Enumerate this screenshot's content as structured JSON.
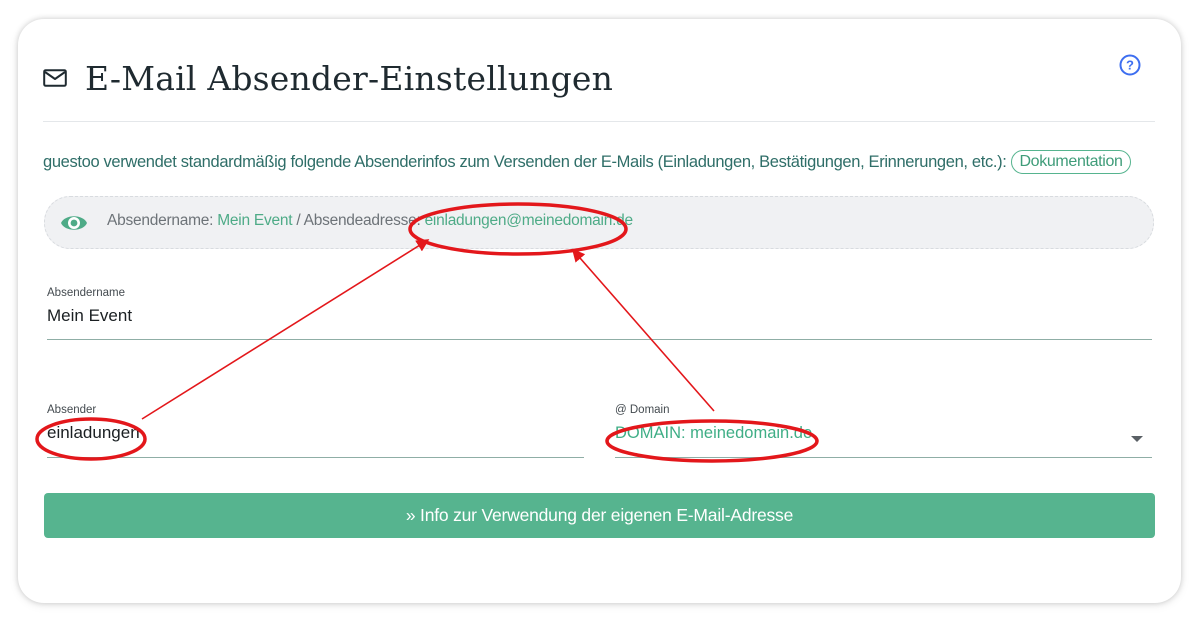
{
  "header": {
    "title": "E-Mail Absender-Einstellungen",
    "envelope_icon": "envelope-icon",
    "help_icon": "help-icon"
  },
  "intro": {
    "text": "guestoo verwendet standardmäßig folgende Absenderinfos zum Versenden der E-Mails (Einladungen, Bestätigungen, Erinnerungen, etc.):",
    "doc_link": "Dokumentation"
  },
  "preview": {
    "icon": "eye-icon",
    "name_label": "Absendername: ",
    "name_value": "Mein Event",
    "separator": " / Absendeadresse: ",
    "address_value": "einladungen@meinedomain.de"
  },
  "form": {
    "sender_name": {
      "label": "Absendername",
      "value": "Mein Event"
    },
    "sender": {
      "label": "Absender",
      "value": "einladungen"
    },
    "domain": {
      "label": "@ Domain",
      "value": "DOMAIN: meinedomain.de"
    }
  },
  "info_button": {
    "label": "» Info zur Verwendung der eigenen E-Mail-Adresse"
  },
  "colors": {
    "accent": "#56b48f",
    "text_teal": "#2f6e68",
    "annotation_red": "#e3171b",
    "help_blue": "#3d6ef0"
  }
}
